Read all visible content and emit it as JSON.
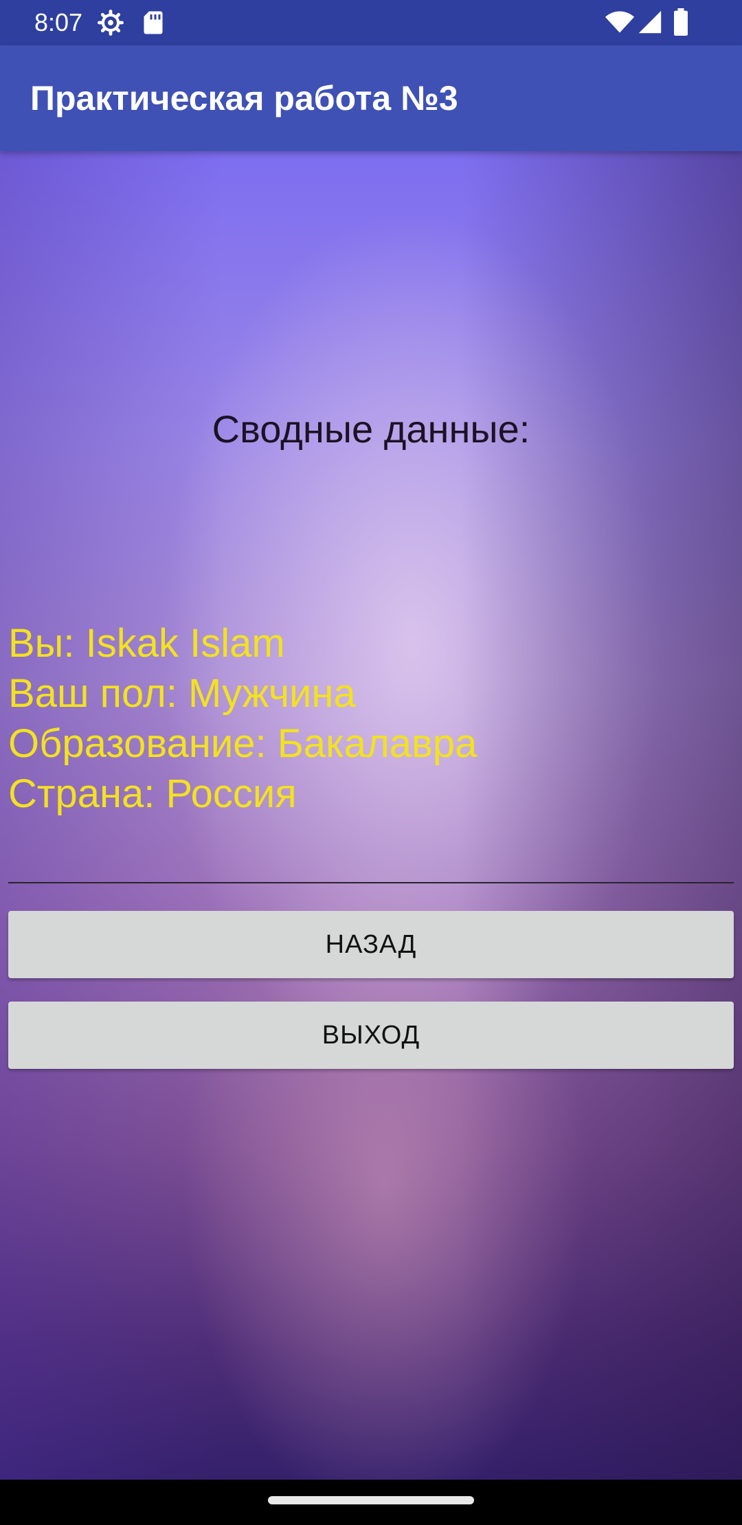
{
  "status_bar": {
    "time": "8:07",
    "icons": [
      "gear-icon",
      "sd-card-icon",
      "wifi-icon",
      "signal-icon",
      "battery-icon"
    ]
  },
  "app_bar": {
    "title": "Практическая работа №3"
  },
  "summary": {
    "title": "Сводные данные:",
    "lines": [
      "Вы: Iskak Islam",
      "Ваш пол: Мужчина",
      "Образование: Бакалавра",
      "Страна: Россия"
    ],
    "text_color": "#f3e21f"
  },
  "buttons": {
    "back_label": "НАЗАД",
    "exit_label": "ВЫХОД"
  },
  "colors": {
    "status_bar": "#2f3f9f",
    "app_bar": "#3f51b5",
    "button_bg": "#d6d7d7"
  }
}
